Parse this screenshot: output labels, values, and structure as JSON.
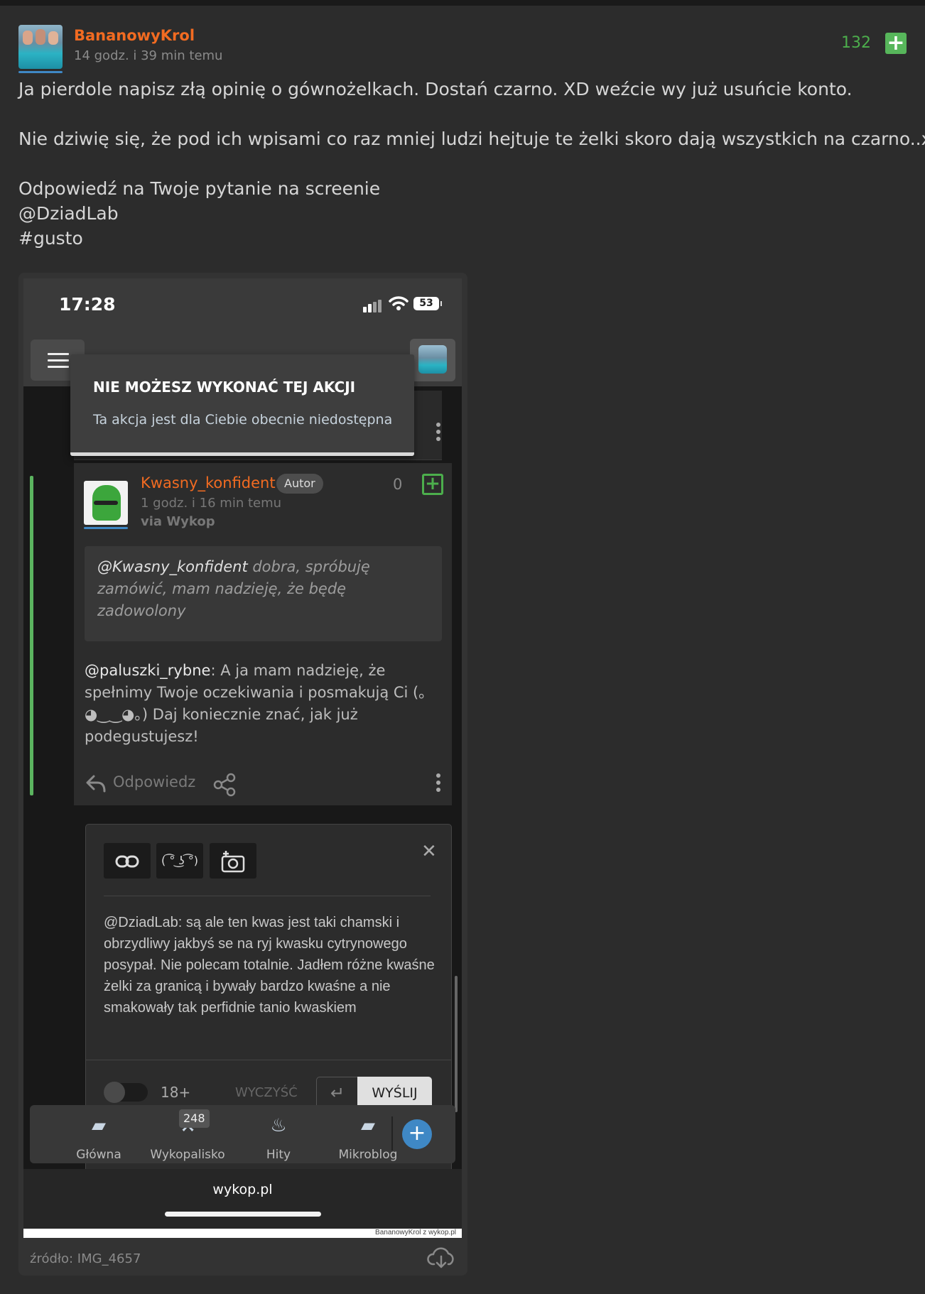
{
  "post": {
    "author": "BananowyKrol",
    "time": "14 godz. i 39 min temu",
    "votes": "132",
    "plus_label": "+",
    "lines": [
      "Ja pierdole napisz złą opinię o gównożelkach. Dostań czarno. XD weźcie wy już usuńcie konto.",
      "Nie dziwię się, że pod ich wpisami co raz mniej ludzi hejtuje te żelki skoro dają wszystkich na czarno..xD",
      "Odpowiedź na Twoje pytanie na screenie",
      "@DziadLab",
      "#gusto"
    ],
    "source": "źródło: IMG_4657"
  },
  "screenshot": {
    "clock": "17:28",
    "battery": "53",
    "toast": {
      "title": "NIE MOŻESZ WYKONAĆ TEJ AKCJI",
      "message": "Ta akcja jest dla Ciebie obecnie niedostępna"
    },
    "comment": {
      "author": "Kwasny_konfident",
      "badge": "Autor",
      "votes": "0",
      "time": "1 godz. i 16 min temu",
      "via": "via Wykop",
      "quote_mention": "@Kwasny_konfident",
      "quote_text": " dobra, spróbuję zamówić, mam nadzieję, że będę zadowolony",
      "body_mention": "@paluszki_rybne",
      "body_text": ": A ja mam nadzieję, że spełnimy Twoje oczekiwania i posmakują Ci (｡◕‿‿◕｡) Daj koniecznie znać, jak już podegustujesz!",
      "reply_label": "Odpowiedz"
    },
    "editor": {
      "tool_lenny": "( ͡° ͜ʖ ͡°)",
      "text": "@DziadLab: są ale ten kwas jest taki chamski i obrzydliwy jakbyś se na ryj kwasku cytrynowego posypał. Nie polecam totalnie. Jadłem różne kwaśne żelki za granicą i bywały bardzo kwaśne a nie smakowały tak perfidnie tanio kwaskiem",
      "age_label": "18+",
      "clear_label": "WYCZYŚĆ",
      "enter_label": "↵",
      "send_label": "WYŚLIJ"
    },
    "bottom_nav": [
      {
        "label": "Główna",
        "icon": "home-icon"
      },
      {
        "label": "Wykopalisko",
        "icon": "shovel-icon",
        "badge": "248"
      },
      {
        "label": "Hity",
        "icon": "flame-icon"
      },
      {
        "label": "Mikroblog",
        "icon": "microblog-icon"
      }
    ],
    "url": "wykop.pl",
    "watermark": "BananowyKrol z wykop.pl"
  },
  "colors": {
    "accent_orange": "#f26b21",
    "vote_green": "#4cae4c",
    "link_blue": "#3f88c5",
    "background": "#2c2c2c"
  }
}
